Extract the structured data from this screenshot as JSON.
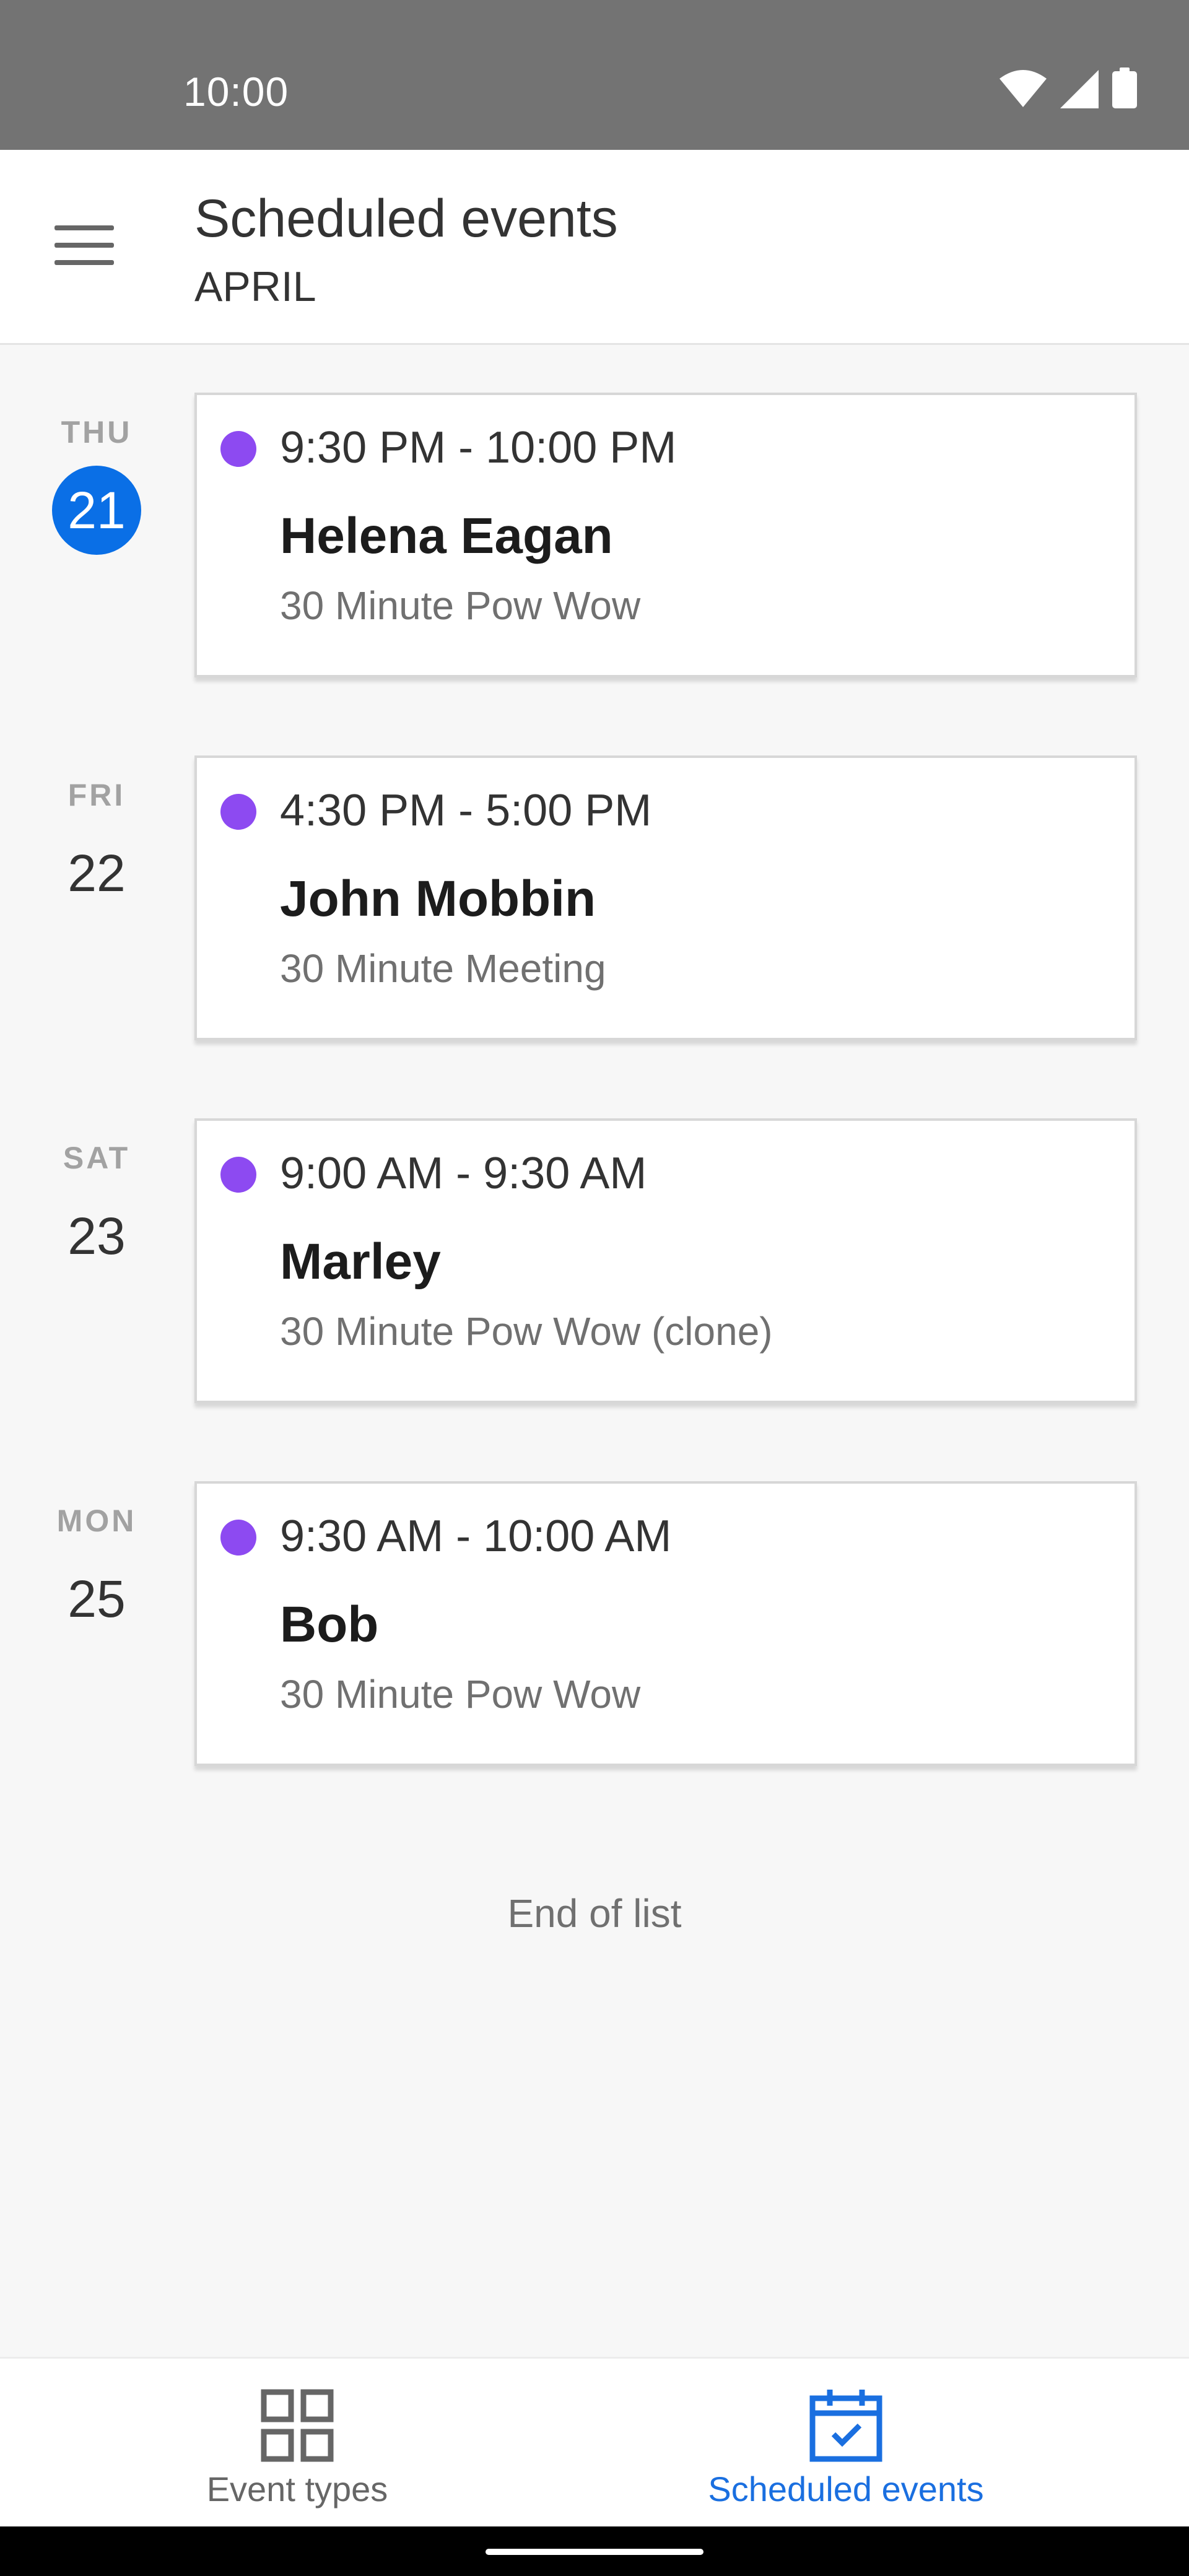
{
  "status_bar": {
    "time": "10:00",
    "icons": [
      "wifi-icon",
      "signal-icon",
      "battery-icon"
    ]
  },
  "app_bar": {
    "menu_icon": "menu-icon",
    "title": "Scheduled events",
    "subtitle": "APRIL"
  },
  "days": [
    {
      "weekday": "THU",
      "date": "21",
      "is_today": true,
      "event": {
        "time": "9:30 PM - 10:00 PM",
        "name": "Helena Eagan",
        "type": "30 Minute Pow Wow",
        "color": "#8d4af1"
      }
    },
    {
      "weekday": "FRI",
      "date": "22",
      "is_today": false,
      "event": {
        "time": "4:30 PM - 5:00 PM",
        "name": "John Mobbin",
        "type": "30 Minute Meeting",
        "color": "#8d4af1"
      }
    },
    {
      "weekday": "SAT",
      "date": "23",
      "is_today": false,
      "event": {
        "time": "9:00 AM - 9:30 AM",
        "name": "Marley",
        "type": "30 Minute Pow Wow (clone)",
        "color": "#8d4af1"
      }
    },
    {
      "weekday": "MON",
      "date": "25",
      "is_today": false,
      "event": {
        "time": "9:30 AM - 10:00 AM",
        "name": "Bob",
        "type": "30 Minute Pow Wow",
        "color": "#8d4af1"
      }
    }
  ],
  "end_of_list": "End of list",
  "bottom_nav": {
    "tabs": [
      {
        "label": "Event types",
        "icon": "grid-icon",
        "active": false
      },
      {
        "label": "Scheduled events",
        "icon": "calendar-check-icon",
        "active": true
      }
    ],
    "active_color": "#1a6fe0",
    "inactive_color": "#666666"
  },
  "colors": {
    "today_highlight": "#0a6fe6",
    "event_dot": "#8d4af1",
    "status_bar": "#737373"
  }
}
